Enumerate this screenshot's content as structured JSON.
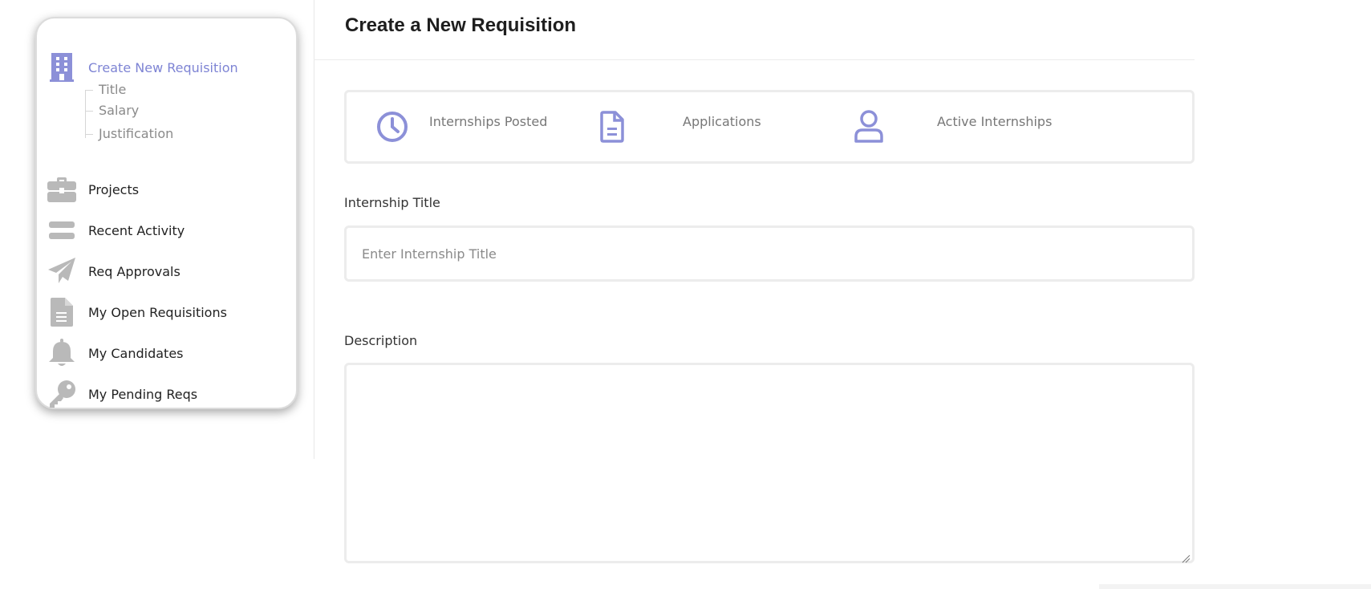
{
  "sidebar": {
    "items": [
      {
        "label": "Create New Requisition",
        "icon": "building-icon"
      },
      {
        "label": "Projects",
        "icon": "briefcase-icon"
      },
      {
        "label": "Recent Activity",
        "icon": "equals-icon"
      },
      {
        "label": "Req Approvals",
        "icon": "paper-plane-icon"
      },
      {
        "label": "My Open Requisitions",
        "icon": "document-icon"
      },
      {
        "label": "My Candidates",
        "icon": "bell-icon"
      },
      {
        "label": "My Pending Reqs",
        "icon": "key-icon"
      }
    ],
    "sub_items": [
      {
        "label": "Title"
      },
      {
        "label": "Salary"
      },
      {
        "label": "Justification"
      }
    ]
  },
  "page": {
    "title": "Create a New Requisition"
  },
  "stats": [
    {
      "label": "Internships Posted",
      "icon": "clock-icon"
    },
    {
      "label": "Applications",
      "icon": "document-icon"
    },
    {
      "label": "Active Internships",
      "icon": "user-icon"
    }
  ],
  "form": {
    "title_label": "Internship Title",
    "title_placeholder": "Enter Internship Title",
    "title_value": "",
    "description_label": "Description",
    "description_value": ""
  },
  "colors": {
    "accent": "#7e84d4",
    "icon_gray": "#b9b9b9",
    "border": "#ececec"
  }
}
